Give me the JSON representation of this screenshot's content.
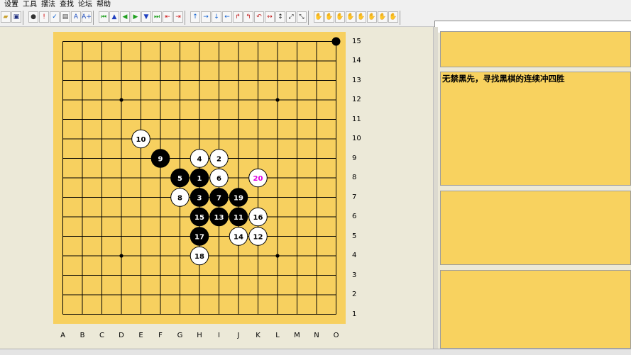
{
  "menu": [
    "设置",
    "工具",
    "摆法",
    "查找",
    "论坛",
    "帮助"
  ],
  "toolbar": {
    "groups": [
      [
        {
          "icon": "open-icon",
          "glyph": "▰",
          "color": "#c8a030"
        },
        {
          "icon": "save-icon",
          "glyph": "▣",
          "color": "#203080"
        }
      ],
      [
        {
          "icon": "stones-icon",
          "glyph": "●",
          "color": "#333333"
        },
        {
          "icon": "mark-icon",
          "glyph": "!",
          "color": "#d00000"
        },
        {
          "icon": "check-icon",
          "glyph": "✓",
          "color": "#1060d0"
        },
        {
          "icon": "image-icon",
          "glyph": "▤",
          "color": "#404040"
        },
        {
          "icon": "font-smaller-icon",
          "glyph": "A",
          "color": "#2050c0"
        },
        {
          "icon": "font-larger-icon",
          "glyph": "A+",
          "color": "#2050c0"
        }
      ],
      [
        {
          "icon": "first-move-icon",
          "glyph": "⏮",
          "color": "#20a020"
        },
        {
          "icon": "up-icon",
          "glyph": "▲",
          "color": "#2040c0"
        },
        {
          "icon": "prev-icon",
          "glyph": "◀",
          "color": "#20a020"
        },
        {
          "icon": "next-icon",
          "glyph": "▶",
          "color": "#20a020"
        },
        {
          "icon": "down-icon",
          "glyph": "▼",
          "color": "#2040c0"
        },
        {
          "icon": "last-move-icon",
          "glyph": "⏭",
          "color": "#20a020"
        },
        {
          "icon": "branch-left-icon",
          "glyph": "⇤",
          "color": "#d02020"
        },
        {
          "icon": "branch-right-icon",
          "glyph": "⇥",
          "color": "#d02020"
        }
      ],
      [
        {
          "icon": "arrow-up-icon",
          "glyph": "↑",
          "color": "#1060d0"
        },
        {
          "icon": "arrow-right-icon",
          "glyph": "→",
          "color": "#1060d0"
        },
        {
          "icon": "arrow-down-icon",
          "glyph": "↓",
          "color": "#1060d0"
        },
        {
          "icon": "arrow-left-icon",
          "glyph": "←",
          "color": "#1060d0"
        },
        {
          "icon": "rotate-cw-icon",
          "glyph": "↱",
          "color": "#c02020"
        },
        {
          "icon": "rotate-ccw-icon",
          "glyph": "↰",
          "color": "#c02020"
        },
        {
          "icon": "undo-icon",
          "glyph": "↶",
          "color": "#c02020"
        },
        {
          "icon": "flip-h-icon",
          "glyph": "↔",
          "color": "#c02020"
        },
        {
          "icon": "flip-v-icon",
          "glyph": "↕",
          "color": "#202020"
        },
        {
          "icon": "diag1-icon",
          "glyph": "⤢",
          "color": "#202020"
        },
        {
          "icon": "diag2-icon",
          "glyph": "⤡",
          "color": "#202020"
        }
      ],
      [
        {
          "icon": "hand-icon-1",
          "glyph": "✋",
          "color": "#303030"
        },
        {
          "icon": "hand-icon-2",
          "glyph": "✋",
          "color": "#303030"
        },
        {
          "icon": "hand-icon-3",
          "glyph": "✋",
          "color": "#303030"
        },
        {
          "icon": "hand-icon-4",
          "glyph": "✋",
          "color": "#303030"
        },
        {
          "icon": "hand-icon-5",
          "glyph": "✋",
          "color": "#303030"
        },
        {
          "icon": "hand-icon-6",
          "glyph": "✋",
          "color": "#303030"
        },
        {
          "icon": "hand-icon-7",
          "glyph": "✋",
          "color": "#303030"
        },
        {
          "icon": "hand-icon-8",
          "glyph": "✋",
          "color": "#303030"
        }
      ]
    ]
  },
  "board": {
    "size": 15,
    "col_labels": [
      "A",
      "B",
      "C",
      "D",
      "E",
      "F",
      "G",
      "H",
      "I",
      "J",
      "K",
      "L",
      "M",
      "N",
      "O"
    ],
    "row_labels": [
      "15",
      "14",
      "13",
      "12",
      "11",
      "10",
      "9",
      "8",
      "7",
      "6",
      "5",
      "4",
      "3",
      "2",
      "1"
    ],
    "star_points": [
      [
        "D",
        "12"
      ],
      [
        "L",
        "12"
      ],
      [
        "D",
        "4"
      ],
      [
        "L",
        "4"
      ],
      [
        "H",
        "8"
      ]
    ],
    "colors": {
      "board": "#f7d05f",
      "line": "#000000",
      "last_move_label": "#e000e0"
    },
    "stones": [
      {
        "col": "H",
        "row": "8",
        "color": "black",
        "label": "1"
      },
      {
        "col": "I",
        "row": "9",
        "color": "white",
        "label": "2"
      },
      {
        "col": "H",
        "row": "7",
        "color": "black",
        "label": "3"
      },
      {
        "col": "H",
        "row": "9",
        "color": "white",
        "label": "4"
      },
      {
        "col": "G",
        "row": "8",
        "color": "black",
        "label": "5"
      },
      {
        "col": "I",
        "row": "8",
        "color": "white",
        "label": "6"
      },
      {
        "col": "I",
        "row": "7",
        "color": "black",
        "label": "7"
      },
      {
        "col": "G",
        "row": "7",
        "color": "white",
        "label": "8"
      },
      {
        "col": "F",
        "row": "9",
        "color": "black",
        "label": "9"
      },
      {
        "col": "E",
        "row": "10",
        "color": "white",
        "label": "10"
      },
      {
        "col": "J",
        "row": "6",
        "color": "black",
        "label": "11"
      },
      {
        "col": "K",
        "row": "5",
        "color": "white",
        "label": "12"
      },
      {
        "col": "I",
        "row": "6",
        "color": "black",
        "label": "13"
      },
      {
        "col": "J",
        "row": "5",
        "color": "white",
        "label": "14"
      },
      {
        "col": "H",
        "row": "6",
        "color": "black",
        "label": "15"
      },
      {
        "col": "K",
        "row": "6",
        "color": "white",
        "label": "16"
      },
      {
        "col": "H",
        "row": "5",
        "color": "black",
        "label": "17"
      },
      {
        "col": "H",
        "row": "4",
        "color": "white",
        "label": "18"
      },
      {
        "col": "J",
        "row": "7",
        "color": "black",
        "label": "19"
      },
      {
        "col": "K",
        "row": "8",
        "color": "white",
        "label": "20",
        "last": true
      },
      {
        "col": "O",
        "row": "15",
        "color": "black",
        "label": ""
      }
    ]
  },
  "panels": {
    "comment": "无禁黑先，寻找黑棋的连续冲四胜"
  }
}
